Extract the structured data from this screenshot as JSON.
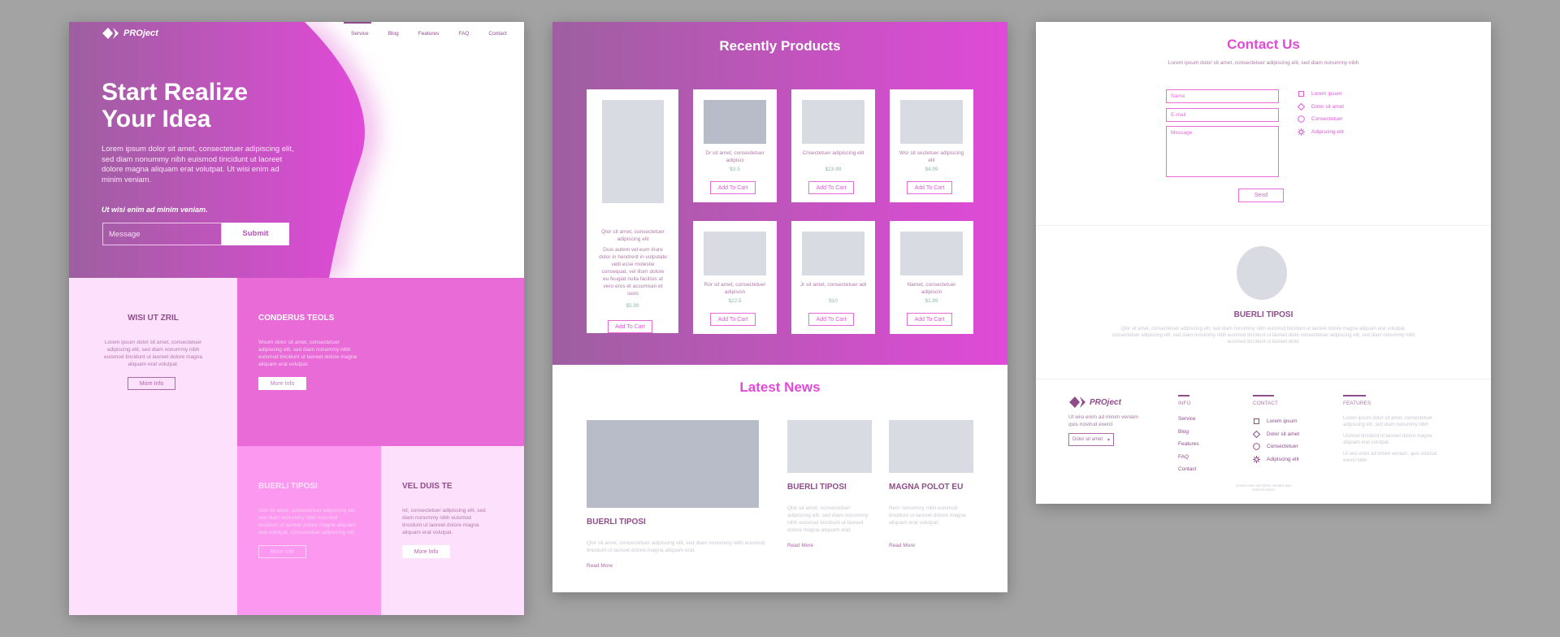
{
  "colors": {
    "brand": "#e04ad8",
    "purple": "#9e5fa0",
    "pink_light": "#fde0fb",
    "pink_mid": "#fd98f0",
    "pink_strong": "#e86bd8",
    "placeholder": "#d9dbe2"
  },
  "landing": {
    "logo": "PROject",
    "nav": [
      "Service",
      "Blog",
      "Features",
      "FAQ",
      "Contact"
    ],
    "hero_title_1": "Start Realize",
    "hero_title_2": "Your Idea",
    "hero_text": "Lorem ipsum dolor sit amet, consectetuer adipiscing elit, sed diam nonummy nibh euismod tincidunt ut laoreet dolore magna aliquam erat volutpat. Ut wisi enim ad minim veniam.",
    "hero_tagline": "Ut wisi enim ad minim veniam.",
    "message_placeholder": "Message",
    "submit": "Submit",
    "blocks": [
      {
        "title": "WISI UT ZRIL",
        "text": "Lorem ipsum dolor sit amet, consectetuer adipiscing elit, sed diam nonummy nibh euismod tincidunt ut laoreet dolore magna aliquam erat volutpat.",
        "button": "More Info"
      },
      {
        "title": "CONDERUS TEOLS",
        "text": "Wsum dolor sit amet, consectetuer adipiscing elit, sed diam nonummy nibh euismod tincidunt ut laoreet dolore magna aliquam erat volutpat.",
        "button": "More Info"
      },
      {
        "title": "BUERLI TIPOSI",
        "text": "Olor sit amet, consectetuer adipiscing elit, sed diam nonummy nibh euismod tincidunt ut laoreet dolore magna aliquam erat volutpat. consectetuer adipiscing elit.",
        "button": "More Info"
      },
      {
        "title": "VEL DUIS TE",
        "text": "Ivt, consectetuer adipiscing elit, sed diam nonummy nibh euismod tincidunt ut laoreet dolore magna aliquam erat volutpat.",
        "button": "More Info"
      }
    ]
  },
  "products": {
    "title": "Recently Products",
    "featured": {
      "name": "Qlor sit amet, consectetuer adipiscing elit",
      "desc": "Duis autem vel eum iriure dolor in hendrerit in vulputate velit esse molestie consequat, vel illum dolore eu feugiat nulla facilisis at vero eros et accumsan et iusto",
      "price": "$5.99",
      "button": "Add To Cart"
    },
    "items": [
      {
        "name": "Dr sit amet, consectetuer adipisci",
        "price": "$3.5",
        "button": "Add To Cart"
      },
      {
        "name": "Cnsectetuer adipiscing elit",
        "price": "$23.99",
        "button": "Add To Cart"
      },
      {
        "name": "Wor sit sectetuer adipiscing elit",
        "price": "$4.99",
        "button": "Add To Cart"
      },
      {
        "name": "Ror sit amet, consectetuer adipiscin",
        "price": "$22.5",
        "button": "Add To Cart"
      },
      {
        "name": "Jr sit amet, consectetuer adi",
        "price": "$10",
        "button": "Add To Cart"
      },
      {
        "name": "Namet, consectetuer adipiscin",
        "price": "$1.99",
        "button": "Add To Cart"
      }
    ]
  },
  "news": {
    "title": "Latest News",
    "items": [
      {
        "title": "BUERLI TIPOSI",
        "text": "Qlor sit amet, consectetuer adipiscing elit, sed diam nonummy nibh euismod tincidunt ut laoreet dolore magna aliquam erat.",
        "link": "Read More"
      },
      {
        "title": "BUERLI TIPOSI",
        "text": "Qlor sit amet, consectetuer adipiscing elit, sed diam nonummy nibh euismod tincidunt ut laoreet dolore magna aliquam erat.",
        "link": "Read More"
      },
      {
        "title": "MAGNA POLOT EU",
        "text": "Rem nonummy nibh euismod tincidunt ut laoreet dolore magna aliquam erat volutpat.",
        "link": "Read More"
      }
    ]
  },
  "contact": {
    "title": "Contact Us",
    "subtitle": "Lorem ipsum dolor sit amet, consectetuer adipiscing elit, sed diam nonummy nibh",
    "name_placeholder": "Name",
    "email_placeholder": "E-mail",
    "message_placeholder": "Message",
    "send": "Send",
    "info": [
      {
        "icon": "square",
        "label": "Lorem ipsum"
      },
      {
        "icon": "diamond",
        "label": "Dolor sit amet"
      },
      {
        "icon": "circle",
        "label": "Consectetuer"
      },
      {
        "icon": "sun",
        "label": "Adipiscing elit"
      }
    ],
    "profile_name": "BUERLI TIPOSI",
    "profile_text": "Qlor sit amet, consectetuer adipiscing elit, sed diam nonummy nibh euismod tincidunt ut laoreet dolore magna aliquam erat volutpat. consectetuer adipiscing elit, sed diam nonummy nibh euismod tincidunt ut laoreet dolor consectetuer adipiscing elit, sed diam nonummy nibh euismod tincidunt ut laoreet dolor",
    "footer": {
      "logo": "PROject",
      "tagline": "Ut wisi enim ad minim veniam quis nostrud exerci",
      "select": "Dolor sit amet",
      "info_title": "INFO",
      "info_links": [
        "Service",
        "Blog",
        "Features",
        "FAQ",
        "Contact"
      ],
      "contact_title": "CONTACT",
      "features_title": "FEATURES",
      "features_text": [
        "Lorem ipsum dolor sit amet, consectetuer adipiscing elit, sed diam nonummy nibh",
        "Uismod tincidunt ut laoreet dolore magna aliquam erat volutpat.",
        "Ut wisi enim ad minim veniam, quis nostrud exerci tatio"
      ],
      "copyright": "Ut wisi enim ad minim veniam quis nostrud exerci"
    }
  }
}
